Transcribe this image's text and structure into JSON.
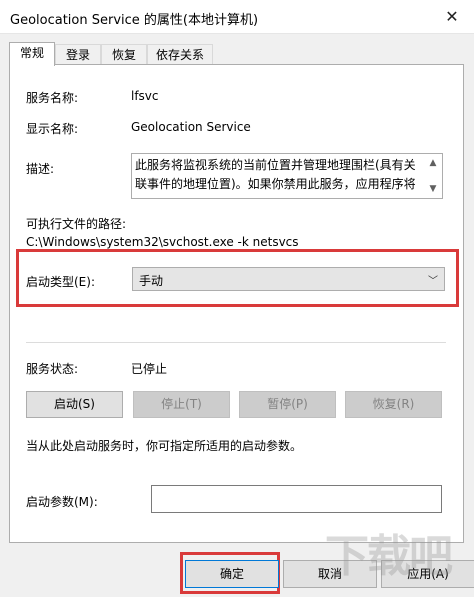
{
  "window": {
    "title": "Geolocation Service 的属性(本地计算机)",
    "close_glyph": "✕"
  },
  "tabs": [
    {
      "label": "常规"
    },
    {
      "label": "登录"
    },
    {
      "label": "恢复"
    },
    {
      "label": "依存关系"
    }
  ],
  "general": {
    "service_name_label": "服务名称:",
    "service_name_value": "lfsvc",
    "display_name_label": "显示名称:",
    "display_name_value": "Geolocation Service",
    "description_label": "描述:",
    "description_value": "此服务将监视系统的当前位置并管理地理围栏(具有关联事件的地理位置)。如果你禁用此服务，应用程序将",
    "exe_path_label": "可执行文件的路径:",
    "exe_path_value": "C:\\Windows\\system32\\svchost.exe -k netsvcs",
    "startup_type_label": "启动类型(E):",
    "startup_type_value": "手动",
    "service_status_label": "服务状态:",
    "service_status_value": "已停止",
    "hint_text": "当从此处启动服务时，你可指定所适用的启动参数。",
    "start_params_label": "启动参数(M):",
    "start_params_value": ""
  },
  "service_buttons": {
    "start": "启动(S)",
    "stop": "停止(T)",
    "pause": "暂停(P)",
    "resume": "恢复(R)"
  },
  "dialog_buttons": {
    "ok": "确定",
    "cancel": "取消",
    "apply": "应用(A)"
  },
  "colors": {
    "highlight_frame": "#d93a3a",
    "primary_button_border": "#0078d7"
  },
  "watermark": "下载吧"
}
